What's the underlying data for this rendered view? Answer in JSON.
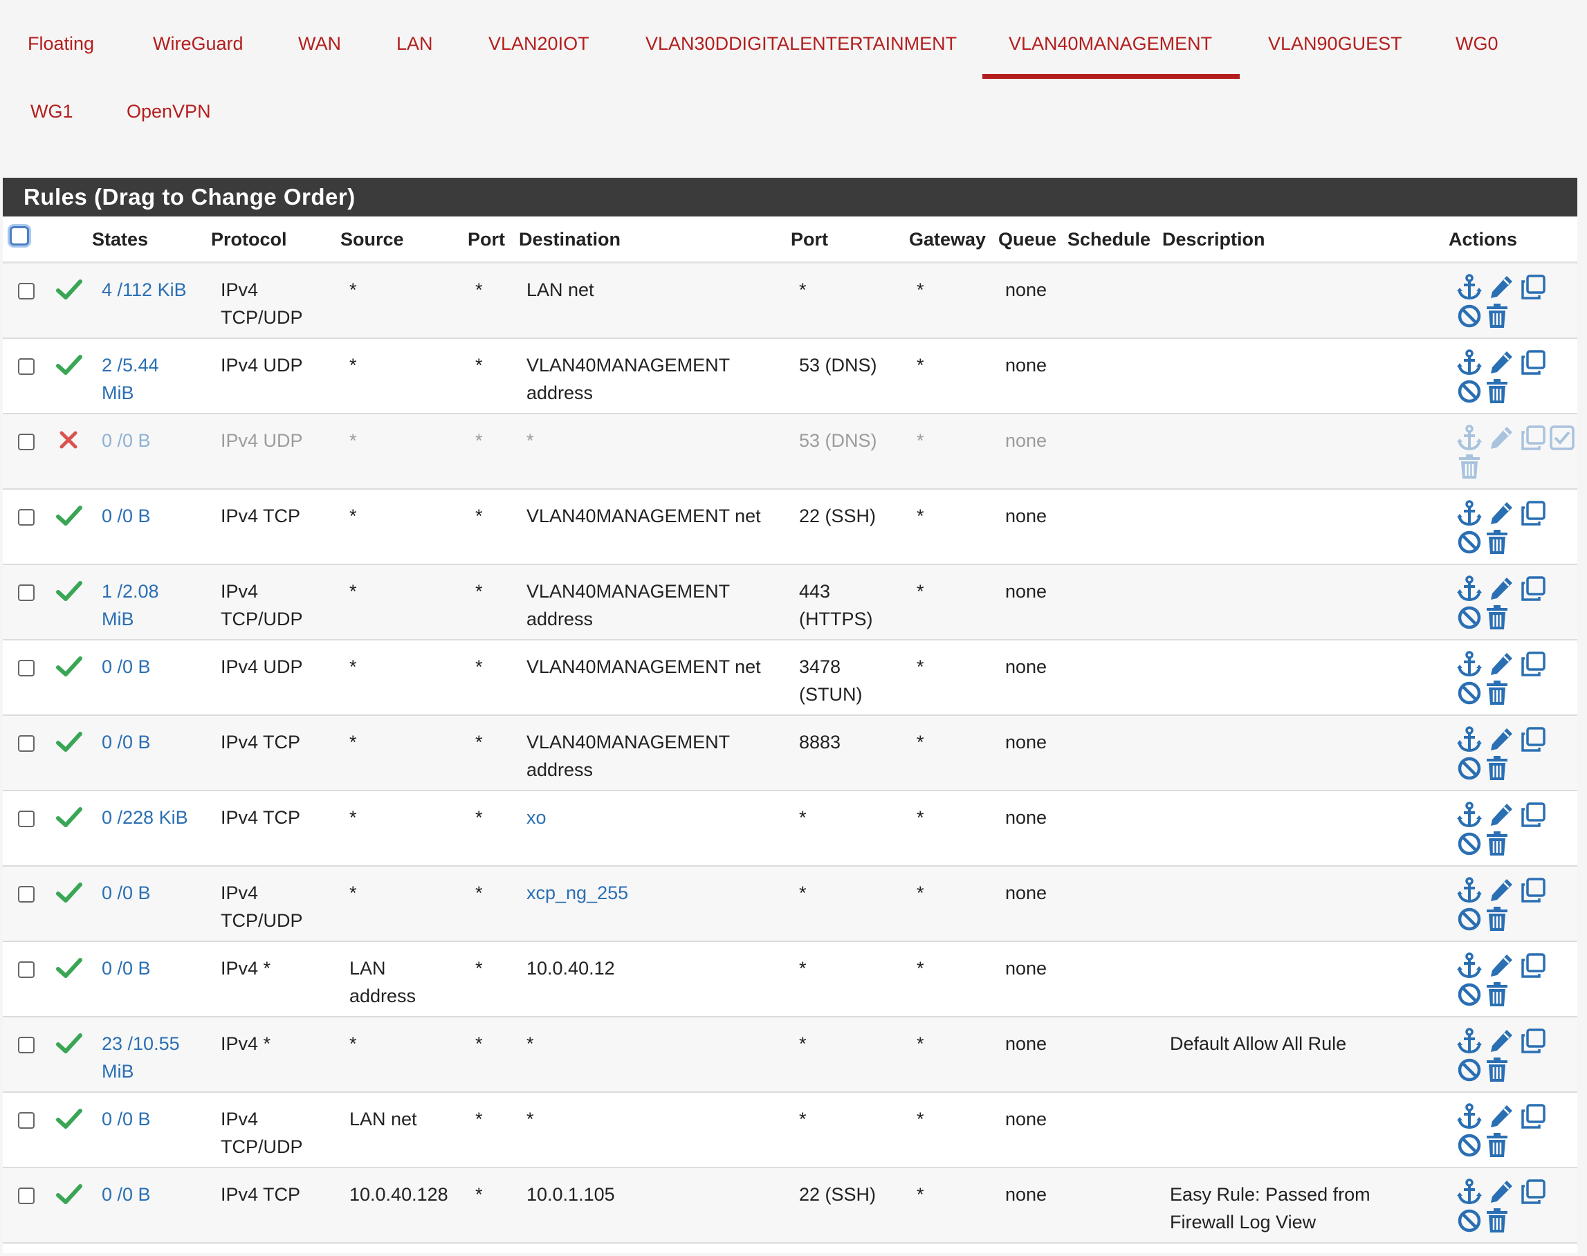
{
  "tabs": [
    {
      "label": "Floating",
      "active": false
    },
    {
      "label": "WireGuard",
      "active": false
    },
    {
      "label": "WAN",
      "active": false
    },
    {
      "label": "LAN",
      "active": false
    },
    {
      "label": "VLAN20IOT",
      "active": false
    },
    {
      "label": "VLAN30DDIGITALENTERTAINMENT",
      "active": false
    },
    {
      "label": "VLAN40MANAGEMENT",
      "active": true
    },
    {
      "label": "VLAN90GUEST",
      "active": false
    },
    {
      "label": "WG0",
      "active": false
    },
    {
      "label": "WG1",
      "active": false
    },
    {
      "label": "OpenVPN",
      "active": false
    }
  ],
  "panel": {
    "title": "Rules (Drag to Change Order)"
  },
  "columns": {
    "states": "States",
    "protocol": "Protocol",
    "source": "Source",
    "src_port": "Port",
    "destination": "Destination",
    "dst_port": "Port",
    "gateway": "Gateway",
    "queue": "Queue",
    "schedule": "Schedule",
    "description": "Description",
    "actions": "Actions"
  },
  "colors": {
    "accent": "#b41e1e",
    "link": "#2a6fb3",
    "pass": "#3aa655",
    "block": "#d9534f",
    "icon": "#2a6fb3",
    "header_bg": "#3b3b3b"
  },
  "icons": {
    "enabled": "check-icon",
    "disabled": "x-icon",
    "actions": [
      "anchor-icon",
      "pencil-icon",
      "copy-icon",
      "disable-icon",
      "trash-icon",
      "enable-icon"
    ]
  },
  "rules": [
    {
      "enabled": true,
      "states": "4 /112 KiB",
      "protocol": "IPv4\nTCP/UDP",
      "source": "*",
      "source_port": "*",
      "destination": "LAN net",
      "destination_link": false,
      "dest_port": "*",
      "gateway": "*",
      "queue": "none",
      "schedule": "",
      "description": ""
    },
    {
      "enabled": true,
      "states": "2 /5.44\nMiB",
      "protocol": "IPv4 UDP",
      "source": "*",
      "source_port": "*",
      "destination": "VLAN40MANAGEMENT\naddress",
      "destination_link": false,
      "dest_port": "53 (DNS)",
      "gateway": "*",
      "queue": "none",
      "schedule": "",
      "description": ""
    },
    {
      "enabled": false,
      "states": "0 /0 B",
      "protocol": "IPv4 UDP",
      "source": "*",
      "source_port": "*",
      "destination": "*",
      "destination_link": false,
      "dest_port": "53 (DNS)",
      "gateway": "*",
      "queue": "none",
      "schedule": "",
      "description": ""
    },
    {
      "enabled": true,
      "states": "0 /0 B",
      "protocol": "IPv4 TCP",
      "source": "*",
      "source_port": "*",
      "destination": "VLAN40MANAGEMENT net",
      "destination_link": false,
      "dest_port": "22 (SSH)",
      "gateway": "*",
      "queue": "none",
      "schedule": "",
      "description": ""
    },
    {
      "enabled": true,
      "states": "1 /2.08\nMiB",
      "protocol": "IPv4\nTCP/UDP",
      "source": "*",
      "source_port": "*",
      "destination": "VLAN40MANAGEMENT\naddress",
      "destination_link": false,
      "dest_port": "443\n(HTTPS)",
      "gateway": "*",
      "queue": "none",
      "schedule": "",
      "description": ""
    },
    {
      "enabled": true,
      "states": "0 /0 B",
      "protocol": "IPv4 UDP",
      "source": "*",
      "source_port": "*",
      "destination": "VLAN40MANAGEMENT net",
      "destination_link": false,
      "dest_port": "3478\n(STUN)",
      "gateway": "*",
      "queue": "none",
      "schedule": "",
      "description": ""
    },
    {
      "enabled": true,
      "states": "0 /0 B",
      "protocol": "IPv4 TCP",
      "source": "*",
      "source_port": "*",
      "destination": "VLAN40MANAGEMENT\naddress",
      "destination_link": false,
      "dest_port": "8883",
      "gateway": "*",
      "queue": "none",
      "schedule": "",
      "description": ""
    },
    {
      "enabled": true,
      "states": "0 /228 KiB",
      "protocol": "IPv4 TCP",
      "source": "*",
      "source_port": "*",
      "destination": "xo",
      "destination_link": true,
      "dest_port": "*",
      "gateway": "*",
      "queue": "none",
      "schedule": "",
      "description": ""
    },
    {
      "enabled": true,
      "states": "0 /0 B",
      "protocol": "IPv4\nTCP/UDP",
      "source": "*",
      "source_port": "*",
      "destination": "xcp_ng_255",
      "destination_link": true,
      "dest_port": "*",
      "gateway": "*",
      "queue": "none",
      "schedule": "",
      "description": ""
    },
    {
      "enabled": true,
      "states": "0 /0 B",
      "protocol": "IPv4 *",
      "source": "LAN\naddress",
      "source_port": "*",
      "destination": "10.0.40.12",
      "destination_link": false,
      "dest_port": "*",
      "gateway": "*",
      "queue": "none",
      "schedule": "",
      "description": ""
    },
    {
      "enabled": true,
      "states": "23 /10.55\nMiB",
      "protocol": "IPv4 *",
      "source": "*",
      "source_port": "*",
      "destination": "*",
      "destination_link": false,
      "dest_port": "*",
      "gateway": "*",
      "queue": "none",
      "schedule": "",
      "description": "Default Allow All Rule"
    },
    {
      "enabled": true,
      "states": "0 /0 B",
      "protocol": "IPv4\nTCP/UDP",
      "source": "LAN net",
      "source_port": "*",
      "destination": "*",
      "destination_link": false,
      "dest_port": "*",
      "gateway": "*",
      "queue": "none",
      "schedule": "",
      "description": ""
    },
    {
      "enabled": true,
      "states": "0 /0 B",
      "protocol": "IPv4 TCP",
      "source": "10.0.40.128",
      "source_port": "*",
      "destination": "10.0.1.105",
      "destination_link": false,
      "dest_port": "22 (SSH)",
      "gateway": "*",
      "queue": "none",
      "schedule": "",
      "description": "Easy Rule: Passed from\nFirewall Log View"
    }
  ]
}
